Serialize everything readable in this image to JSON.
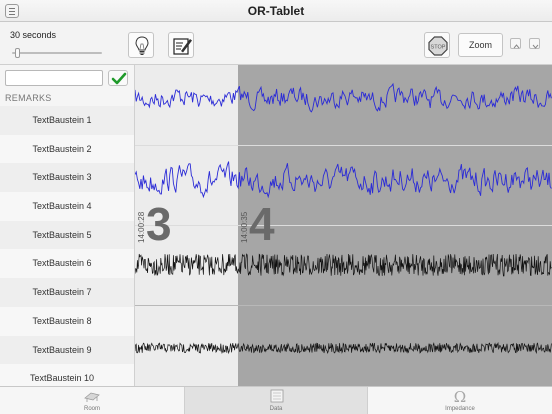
{
  "app": {
    "title": "OR-Tablet"
  },
  "toolbar": {
    "duration_label": "30 seconds",
    "duration_slider_value": 0.03,
    "zoom_label": "Zoom"
  },
  "remarks": {
    "search_value": "",
    "header": "REMARKS",
    "items": [
      "TextBaustein 1",
      "TextBaustein 2",
      "TextBaustein 3",
      "TextBaustein 4",
      "TextBaustein 5",
      "TextBaustein 6",
      "TextBaustein 7",
      "TextBaustein 8",
      "TextBaustein 9",
      "TextBaustein 10"
    ]
  },
  "markers": [
    {
      "time": "14:00:28",
      "number": "3"
    },
    {
      "time": "14:00:35",
      "number": "4"
    }
  ],
  "traces": [
    {
      "color": "#2b2bd6",
      "style": "emg"
    },
    {
      "color": "#2b2bd6",
      "style": "emg"
    },
    {
      "color": "#111111",
      "style": "noise"
    },
    {
      "color": "#111111",
      "style": "noise-small"
    }
  ],
  "tabs": [
    {
      "label": "Room",
      "icon": "room-icon",
      "active": false
    },
    {
      "label": "Data",
      "icon": "data-icon",
      "active": true
    },
    {
      "label": "Impedance",
      "icon": "omega-icon",
      "active": false
    }
  ],
  "colors": {
    "accent_check": "#1f9a2a",
    "shade": "#a6a6a6"
  }
}
